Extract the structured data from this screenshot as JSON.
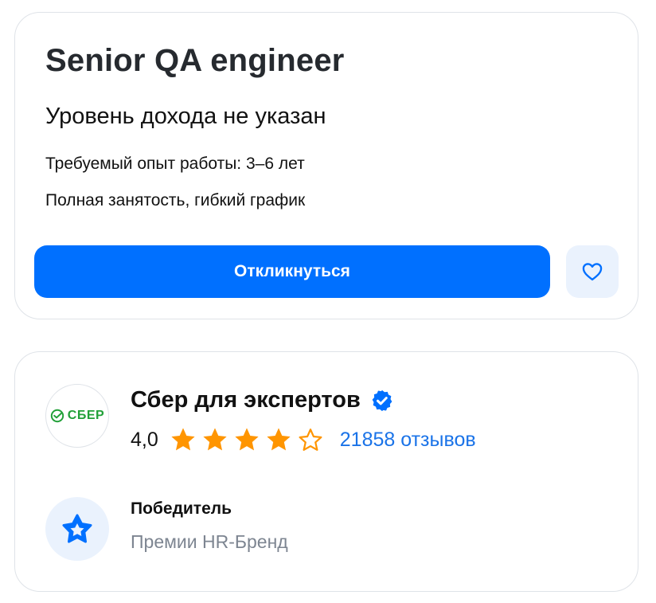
{
  "vacancy": {
    "title": "Senior QA engineer",
    "salary": "Уровень дохода не указан",
    "experience": "Требуемый опыт работы: 3–6 лет",
    "employment": "Полная занятость, гибкий график",
    "apply_label": "Откликнуться",
    "favorite_icon": "heart-icon"
  },
  "company": {
    "logo_text": "СБЕР",
    "name": "Сбер для экспертов",
    "verified_icon": "verified-badge-icon",
    "rating": "4,0",
    "rating_numeric": 4,
    "rating_max": 5,
    "reviews": "21858 отзывов",
    "award": {
      "title": "Победитель",
      "subtitle": "Премии HR-Бренд",
      "icon": "award-star-icon"
    }
  },
  "colors": {
    "accent": "#0070ff",
    "star": "#ff9500",
    "link": "#1a73e8",
    "sber_green": "#21a038",
    "muted": "#7d8591"
  }
}
